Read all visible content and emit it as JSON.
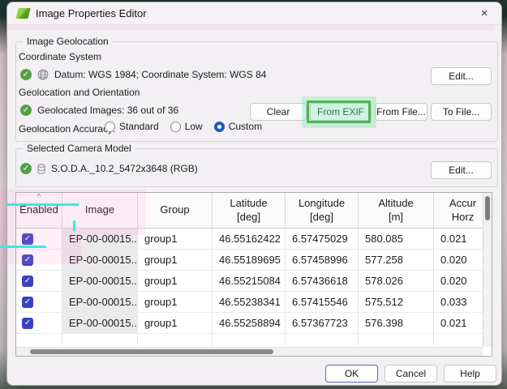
{
  "window": {
    "title": "Image Properties Editor",
    "close_label": "×"
  },
  "geo": {
    "group_title": "Image Geolocation",
    "coord_label": "Coordinate System",
    "coord_value": "Datum: WGS 1984; Coordinate System: WGS 84",
    "coord_edit": "Edit...",
    "orient_label": "Geolocation and Orientation",
    "geolocated": "Geolocated Images: 36 out of 36",
    "btn_clear": "Clear",
    "btn_from_exif": "From EXIF",
    "btn_from_file": "From File...",
    "btn_to_file": "To File...",
    "accuracy_label": "Geolocation Accuracy:",
    "radio_standard": "Standard",
    "radio_low": "Low",
    "radio_custom": "Custom",
    "accuracy_selected": "Custom"
  },
  "camera": {
    "group_title": "Selected Camera Model",
    "model": "S.O.D.A._10.2_5472x3648 (RGB)",
    "edit": "Edit..."
  },
  "table": {
    "sort_indicator": "^",
    "columns": [
      "Enabled",
      "Image",
      "Group",
      "Latitude\n[deg]",
      "Longitude\n[deg]",
      "Altitude\n[m]",
      "Accur\nHorz"
    ],
    "rows": [
      {
        "enabled": true,
        "image": "EP-00-00015...",
        "group": "group1",
        "latitude": "46.55162422",
        "longitude": "6.57475029",
        "altitude": "580.085",
        "accuracy_horz": "0.021"
      },
      {
        "enabled": true,
        "image": "EP-00-00015...",
        "group": "group1",
        "latitude": "46.55189695",
        "longitude": "6.57458996",
        "altitude": "577.258",
        "accuracy_horz": "0.020"
      },
      {
        "enabled": true,
        "image": "EP-00-00015...",
        "group": "group1",
        "latitude": "46.55215084",
        "longitude": "6.57436618",
        "altitude": "578.026",
        "accuracy_horz": "0.020"
      },
      {
        "enabled": true,
        "image": "EP-00-00015...",
        "group": "group1",
        "latitude": "46.55238341",
        "longitude": "6.57415546",
        "altitude": "575.512",
        "accuracy_horz": "0.033"
      },
      {
        "enabled": true,
        "image": "EP-00-00015...",
        "group": "group1",
        "latitude": "46.55258894",
        "longitude": "6.57367723",
        "altitude": "576.398",
        "accuracy_horz": "0.021"
      }
    ]
  },
  "footer": {
    "ok": "OK",
    "cancel": "Cancel",
    "help": "Help"
  },
  "colors": {
    "checkbox_blue": "#3c41c4",
    "radio_selected_blue": "#1d5cc4",
    "status_green": "#57a046",
    "annotation_green": "#54b058",
    "annotation_cyan": "#3ee6e6",
    "dialog_bg": "#f2f0f3"
  }
}
